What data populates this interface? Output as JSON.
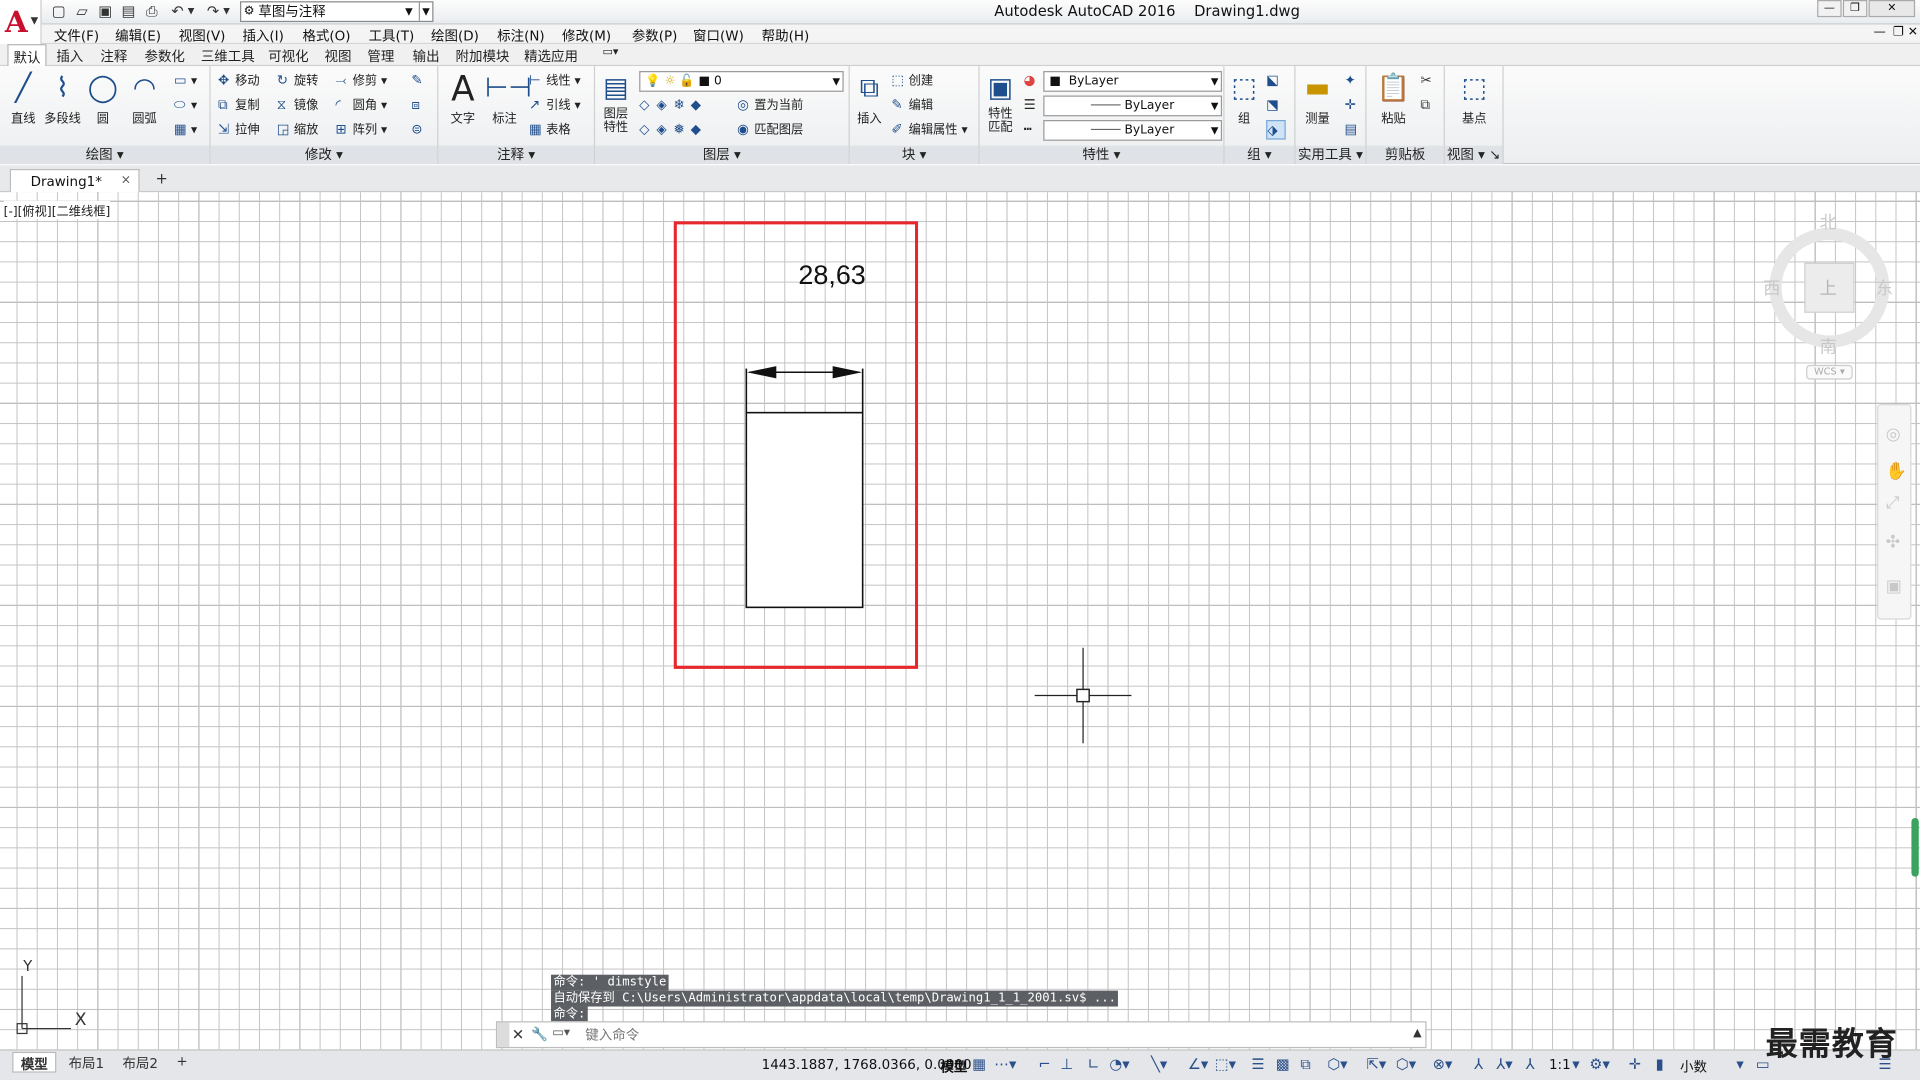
{
  "app": {
    "logo_letter": "A",
    "title": "Autodesk AutoCAD 2016",
    "filename": "Drawing1.dwg",
    "workspace": "草图与注释"
  },
  "menu": [
    "文件(F)",
    "编辑(E)",
    "视图(V)",
    "插入(I)",
    "格式(O)",
    "工具(T)",
    "绘图(D)",
    "标注(N)",
    "修改(M)",
    "参数(P)",
    "窗口(W)",
    "帮助(H)"
  ],
  "ribbon_tabs": [
    "默认",
    "插入",
    "注释",
    "参数化",
    "三维工具",
    "可视化",
    "视图",
    "管理",
    "输出",
    "附加模块",
    "精选应用"
  ],
  "panels": {
    "draw": {
      "title": "绘图",
      "line": "直线",
      "polyline": "多段线",
      "circle": "圆",
      "arc": "圆弧"
    },
    "modify": {
      "title": "修改",
      "move": "移动",
      "rotate": "旋转",
      "trim": "修剪",
      "copy": "复制",
      "mirror": "镜像",
      "fillet": "圆角",
      "stretch": "拉伸",
      "scale": "缩放",
      "array": "阵列"
    },
    "annotation": {
      "title": "注释",
      "text": "文字",
      "dimension": "标注",
      "linear": "线性",
      "leader": "引线",
      "table": "表格"
    },
    "layers": {
      "title": "图层",
      "props": "图层\n特性",
      "layer_value": "0",
      "set_current": "置为当前",
      "match_layer": "匹配图层"
    },
    "block": {
      "title": "块",
      "insert": "插入",
      "create": "创建",
      "edit": "编辑",
      "edit_attr": "编辑属性"
    },
    "properties": {
      "title": "特性",
      "match": "特性\n匹配",
      "color": "ByLayer",
      "linetype": "ByLayer",
      "lineweight": "ByLayer"
    },
    "group": {
      "title": "组",
      "group": "组"
    },
    "utilities": {
      "title": "实用工具",
      "measure": "测量"
    },
    "clipboard": {
      "title": "剪贴板",
      "paste": "粘贴"
    },
    "view": {
      "title": "视图",
      "base": "基点"
    }
  },
  "doc_tab": {
    "name": "Drawing1*",
    "close": "×",
    "add": "+"
  },
  "viewport": {
    "label": "[-][俯视][二维线框]",
    "dimension_text": "28,63",
    "compass": {
      "n": "北",
      "s": "南",
      "e": "东",
      "w": "西",
      "cube": "上"
    },
    "wcs": "WCS",
    "ucs_x": "X",
    "ucs_y": "Y"
  },
  "colors": {
    "accent_red": "#e8262b",
    "grid_major": "#7a7a7a",
    "grid_minor": "#c3c3c3",
    "cmd_bg": "#5c5f63"
  },
  "command": {
    "history": [
      "命令: ' dimstyle",
      "自动保存到 C:\\Users\\Administrator\\appdata\\local\\temp\\Drawing1_1_1_2001.sv$ ...",
      "命令:"
    ],
    "placeholder": "键入命令"
  },
  "status": {
    "layouts": [
      "模型",
      "布局1",
      "布局2"
    ],
    "add_layout": "+",
    "coords": "1443.1887, 1768.0366, 0.0000",
    "model": "模型",
    "scale": "1:1",
    "units": "小数"
  },
  "watermark": "最需教育"
}
